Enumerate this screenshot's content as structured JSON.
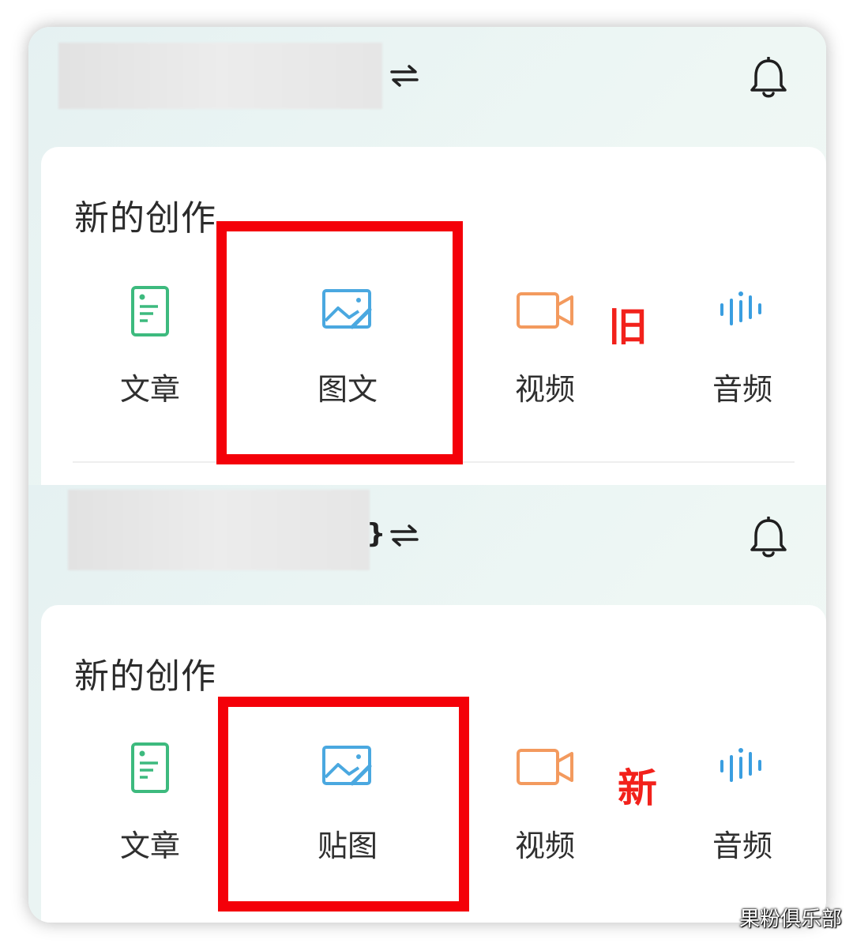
{
  "old_screen": {
    "card_title": "新的创作",
    "tiles": [
      {
        "label": "文章",
        "icon": "article-icon"
      },
      {
        "label": "图文",
        "icon": "image-text-icon"
      },
      {
        "label": "视频",
        "icon": "video-icon"
      },
      {
        "label": "音频",
        "icon": "audio-icon"
      }
    ],
    "annotation": "旧"
  },
  "new_screen": {
    "header_fragment": "}",
    "card_title": "新的创作",
    "tiles": [
      {
        "label": "文章",
        "icon": "article-icon"
      },
      {
        "label": "贴图",
        "icon": "image-text-icon"
      },
      {
        "label": "视频",
        "icon": "video-icon"
      },
      {
        "label": "音频",
        "icon": "audio-icon"
      }
    ],
    "annotation": "新"
  },
  "watermark": "果粉俱乐部",
  "colors": {
    "highlight": "#f40009",
    "article_icon": "#3dba7e",
    "image_icon": "#4aa8e0",
    "video_icon": "#f39a5e",
    "audio_icon": "#3a9ee0"
  }
}
